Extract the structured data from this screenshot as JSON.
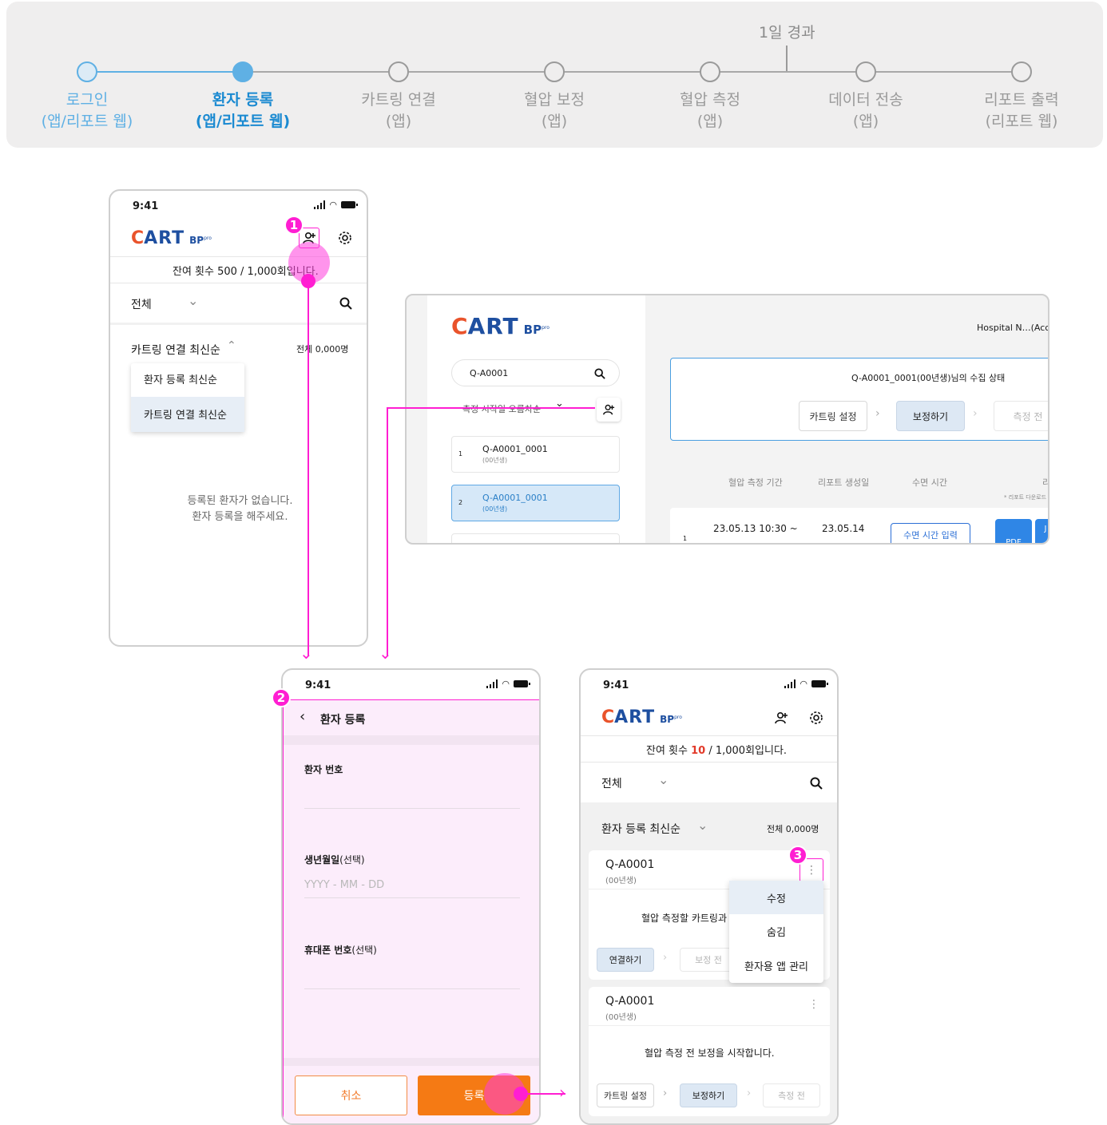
{
  "stepper": {
    "top_note": "1일 경과",
    "steps": [
      {
        "line1": "로그인",
        "line2": "(앱/리포트 웹)",
        "state": "done"
      },
      {
        "line1": "환자 등록",
        "line2": "(앱/리포트 웹)",
        "state": "current"
      },
      {
        "line1": "카트링 연결",
        "line2": "(앱)",
        "state": "todo"
      },
      {
        "line1": "혈압 보정",
        "line2": "(앱)",
        "state": "todo"
      },
      {
        "line1": "혈압 측정",
        "line2": "(앱)",
        "state": "todo"
      },
      {
        "line1": "데이터 전송",
        "line2": "(앱)",
        "state": "todo"
      },
      {
        "line1": "리포트 출력",
        "line2": "(리포트 웹)",
        "state": "todo"
      }
    ],
    "colors": {
      "done": "#5fb0e4",
      "current": "#1b8ad1",
      "todo": "#9a9a9a"
    }
  },
  "logo": {
    "c": "C",
    "art": "ART",
    "bp": "BP",
    "pro": "pro"
  },
  "phone1": {
    "time": "9:41",
    "remaining": "잔여 횟수 500 / 1,000회입니다.",
    "filter": "전체",
    "sort_label": "카트링 연결 최신순",
    "total": "전체 0,000명",
    "dropdown": [
      "환자 등록 최신순",
      "카트링 연결 최신순"
    ],
    "empty_line1": "등록된 환자가 없습니다.",
    "empty_line2": "환자 등록을 해주세요."
  },
  "web": {
    "search_value": "Q-A0001",
    "sort_label": "측정 시작일 오름차순",
    "list": [
      {
        "no": "1",
        "id": "Q-A0001_0001",
        "sub": "(00년생)"
      },
      {
        "no": "2",
        "id": "Q-A0001_0001",
        "sub": "(00년생)"
      }
    ],
    "hospital": "Hospital N…(Acc",
    "status_title": "Q-A0001_0001(00년생)님의 수집 상태",
    "status_steps": [
      "카트링 설정",
      "보정하기",
      "측정 전"
    ],
    "columns": [
      "혈압 측정 기간",
      "리포트 생성일",
      "수면 시간",
      "리"
    ],
    "note": "* 리포트 다운로드",
    "row": {
      "no": "1",
      "period": "23.05.13  10:30 ~",
      "created": "23.05.14",
      "sleep_btn": "수면 시간 입력",
      "pdf": "PDF",
      "j": "J"
    }
  },
  "phone2": {
    "time": "9:41",
    "title": "환자 등록",
    "field1_label": "환자 번호",
    "field2_label": "생년월일",
    "field2_opt": "(선택)",
    "field2_placeholder": "YYYY - MM - DD",
    "field3_label": "휴대폰 번호",
    "field3_opt": "(선택)",
    "cancel": "취소",
    "submit": "등록"
  },
  "phone3": {
    "time": "9:41",
    "remaining_pre": "잔여 횟수 ",
    "remaining_num": "10",
    "remaining_post": " / 1,000회입니다.",
    "filter": "전체",
    "sort_label": "환자 등록 최신순",
    "total": "전체 0,000명",
    "card1": {
      "id": "Q-A0001",
      "sub": "(00년생)",
      "msg": "혈압 측정할 카트링과",
      "chips": [
        "연결하기",
        "보정 전"
      ]
    },
    "menu": [
      "수정",
      "숨김",
      "환자용 앱 관리"
    ],
    "card2": {
      "id": "Q-A0001",
      "sub": "(00년생)",
      "msg": "혈압 측정 전 보정을 시작합니다.",
      "chips": [
        "카트링 설정",
        "보정하기",
        "측정 전"
      ]
    }
  },
  "badges": [
    "1",
    "2",
    "3"
  ]
}
